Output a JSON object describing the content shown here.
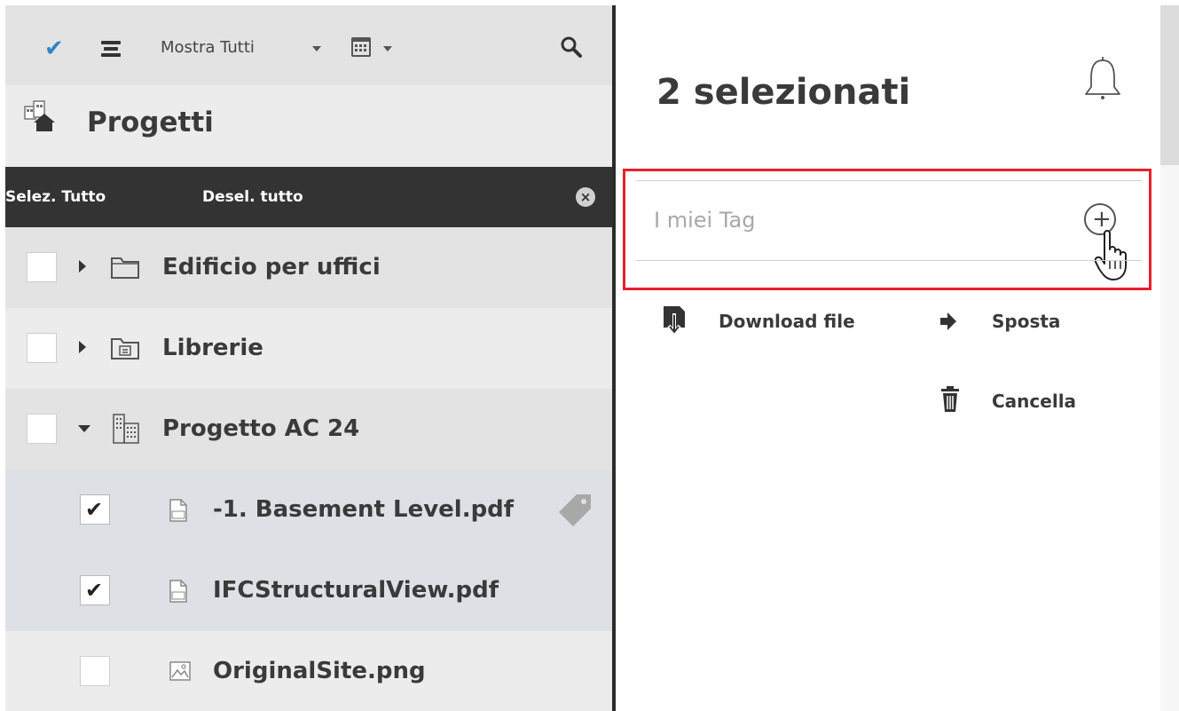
{
  "toolbar": {
    "check_icon": "check-icon",
    "list_icon": "list-icon",
    "filter_label": "Mostra Tutti",
    "calendar_icon": "calendar-icon",
    "search_icon": "search-icon"
  },
  "sidebar": {
    "title": "Progetti",
    "select_all": "Selez. Tutto",
    "deselect_all": "Desel. tutto",
    "items": [
      {
        "label": "Edificio per uffici",
        "icon": "folder-icon",
        "expanded": false,
        "checked": false
      },
      {
        "label": "Librerie",
        "icon": "library-folder-icon",
        "expanded": false,
        "checked": false
      },
      {
        "label": "Progetto AC 24",
        "icon": "building-icon",
        "expanded": true,
        "checked": false
      },
      {
        "label": "-1. Basement Level.pdf",
        "icon": "pdf-file-icon",
        "checked": true,
        "tagged": true
      },
      {
        "label": "IFCStructuralView.pdf",
        "icon": "pdf-file-icon",
        "checked": true
      },
      {
        "label": "OriginalSite.png",
        "icon": "image-file-icon",
        "checked": false
      }
    ]
  },
  "detail": {
    "title": "2 selezionati",
    "tag_placeholder": "I miei Tag",
    "actions": {
      "download": "Download file",
      "move": "Sposta",
      "delete": "Cancella"
    }
  },
  "colors": {
    "accent": "#2f86c9",
    "highlight_border": "#e8202a",
    "selbar": "#333333"
  }
}
